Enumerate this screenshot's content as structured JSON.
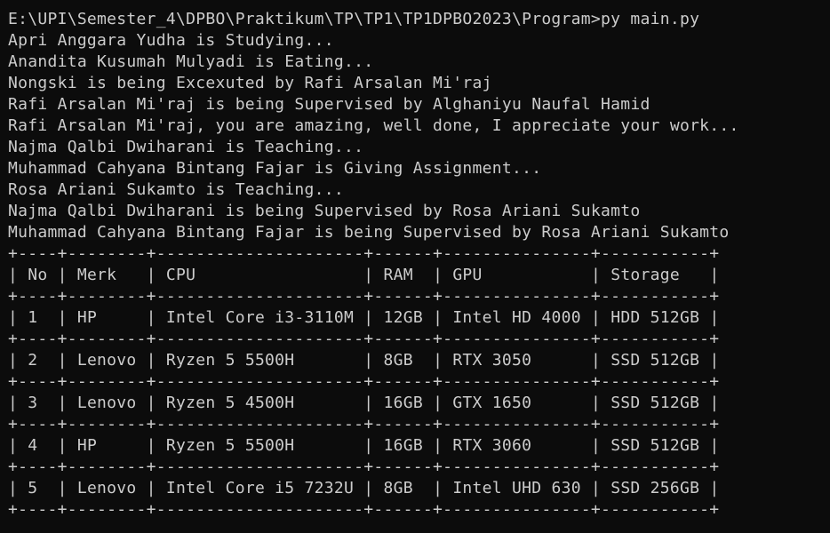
{
  "terminal": {
    "prompt_path": "E:\\UPI\\Semester_4\\DPBO\\Praktikum\\TP\\TP1\\TP1DPBO2023\\Program>",
    "command": "py main.py",
    "output_lines": [
      "Apri Anggara Yudha is Studying...",
      "Anandita Kusumah Mulyadi is Eating...",
      "Nongski is being Excexuted by Rafi Arsalan Mi'raj",
      "Rafi Arsalan Mi'raj is being Supervised by Alghaniyu Naufal Hamid",
      "Rafi Arsalan Mi'raj, you are amazing, well done, I appreciate your work...",
      "Najma Qalbi Dwiharani is Teaching...",
      "Muhammad Cahyana Bintang Fajar is Giving Assignment...",
      "Rosa Ariani Sukamto is Teaching...",
      "Najma Qalbi Dwiharani is being Supervised by Rosa Ariani Sukamto",
      "Muhammad Cahyana Bintang Fajar is being Supervised by Rosa Ariani Sukamto"
    ],
    "table": {
      "headers": [
        "No",
        "Merk",
        "CPU",
        "RAM",
        "GPU",
        "Storage"
      ],
      "rows": [
        [
          "1",
          "HP",
          "Intel Core i3-3110M",
          "12GB",
          "Intel HD 4000",
          "HDD 512GB"
        ],
        [
          "2",
          "Lenovo",
          "Ryzen 5 5500H",
          "8GB",
          "RTX 3050",
          "SSD 512GB"
        ],
        [
          "3",
          "Lenovo",
          "Ryzen 5 4500H",
          "16GB",
          "GTX 1650",
          "SSD 512GB"
        ],
        [
          "4",
          "HP",
          "Ryzen 5 5500H",
          "16GB",
          "RTX 3060",
          "SSD 512GB"
        ],
        [
          "5",
          "Lenovo",
          "Intel Core i5 7232U",
          "8GB",
          "Intel UHD 630",
          "SSD 256GB"
        ]
      ]
    }
  },
  "colors": {
    "background": "#0c0c0c",
    "text": "#cccccc"
  }
}
